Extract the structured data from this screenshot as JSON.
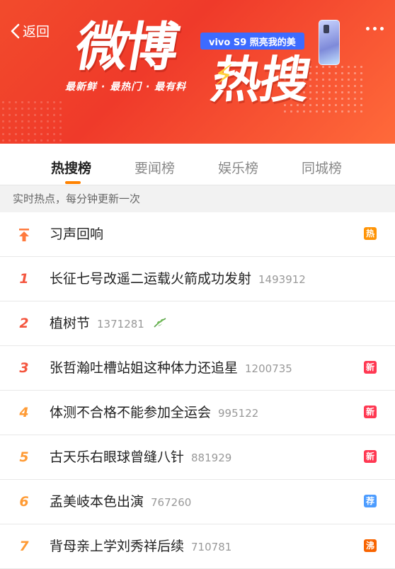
{
  "header": {
    "back_label": "返回",
    "logo_text_1": "微博",
    "logo_text_2": "热搜",
    "slogan": "最新鲜 · 最热门 · 最有料",
    "ad_text": "vivo S9 照亮我的美"
  },
  "tabs": [
    {
      "label": "热搜榜",
      "active": true
    },
    {
      "label": "要闻榜",
      "active": false
    },
    {
      "label": "娱乐榜",
      "active": false
    },
    {
      "label": "同城榜",
      "active": false
    }
  ],
  "notice": "实时热点，每分钟更新一次",
  "list": [
    {
      "rank": "",
      "title": "习声回响",
      "count": "",
      "badge": "热",
      "badge_color": "#ff9406"
    },
    {
      "rank": "1",
      "title": "长征七号改遥二运载火箭成功发射",
      "count": "1493912",
      "badge": "",
      "badge_color": ""
    },
    {
      "rank": "2",
      "title": "植树节",
      "count": "1371281",
      "badge": "",
      "badge_color": ""
    },
    {
      "rank": "3",
      "title": "张哲瀚吐槽站姐这种体力还追星",
      "count": "1200735",
      "badge": "新",
      "badge_color": "#ff3852"
    },
    {
      "rank": "4",
      "title": "体测不合格不能参加全运会",
      "count": "995122",
      "badge": "新",
      "badge_color": "#ff3852"
    },
    {
      "rank": "5",
      "title": "古天乐右眼球曾缝八针",
      "count": "881929",
      "badge": "新",
      "badge_color": "#ff3852"
    },
    {
      "rank": "6",
      "title": "孟美岐本色出演",
      "count": "767260",
      "badge": "荐",
      "badge_color": "#4c9cff"
    },
    {
      "rank": "7",
      "title": "背母亲上学刘秀祥后续",
      "count": "710781",
      "badge": "沸",
      "badge_color": "#f86400"
    }
  ]
}
